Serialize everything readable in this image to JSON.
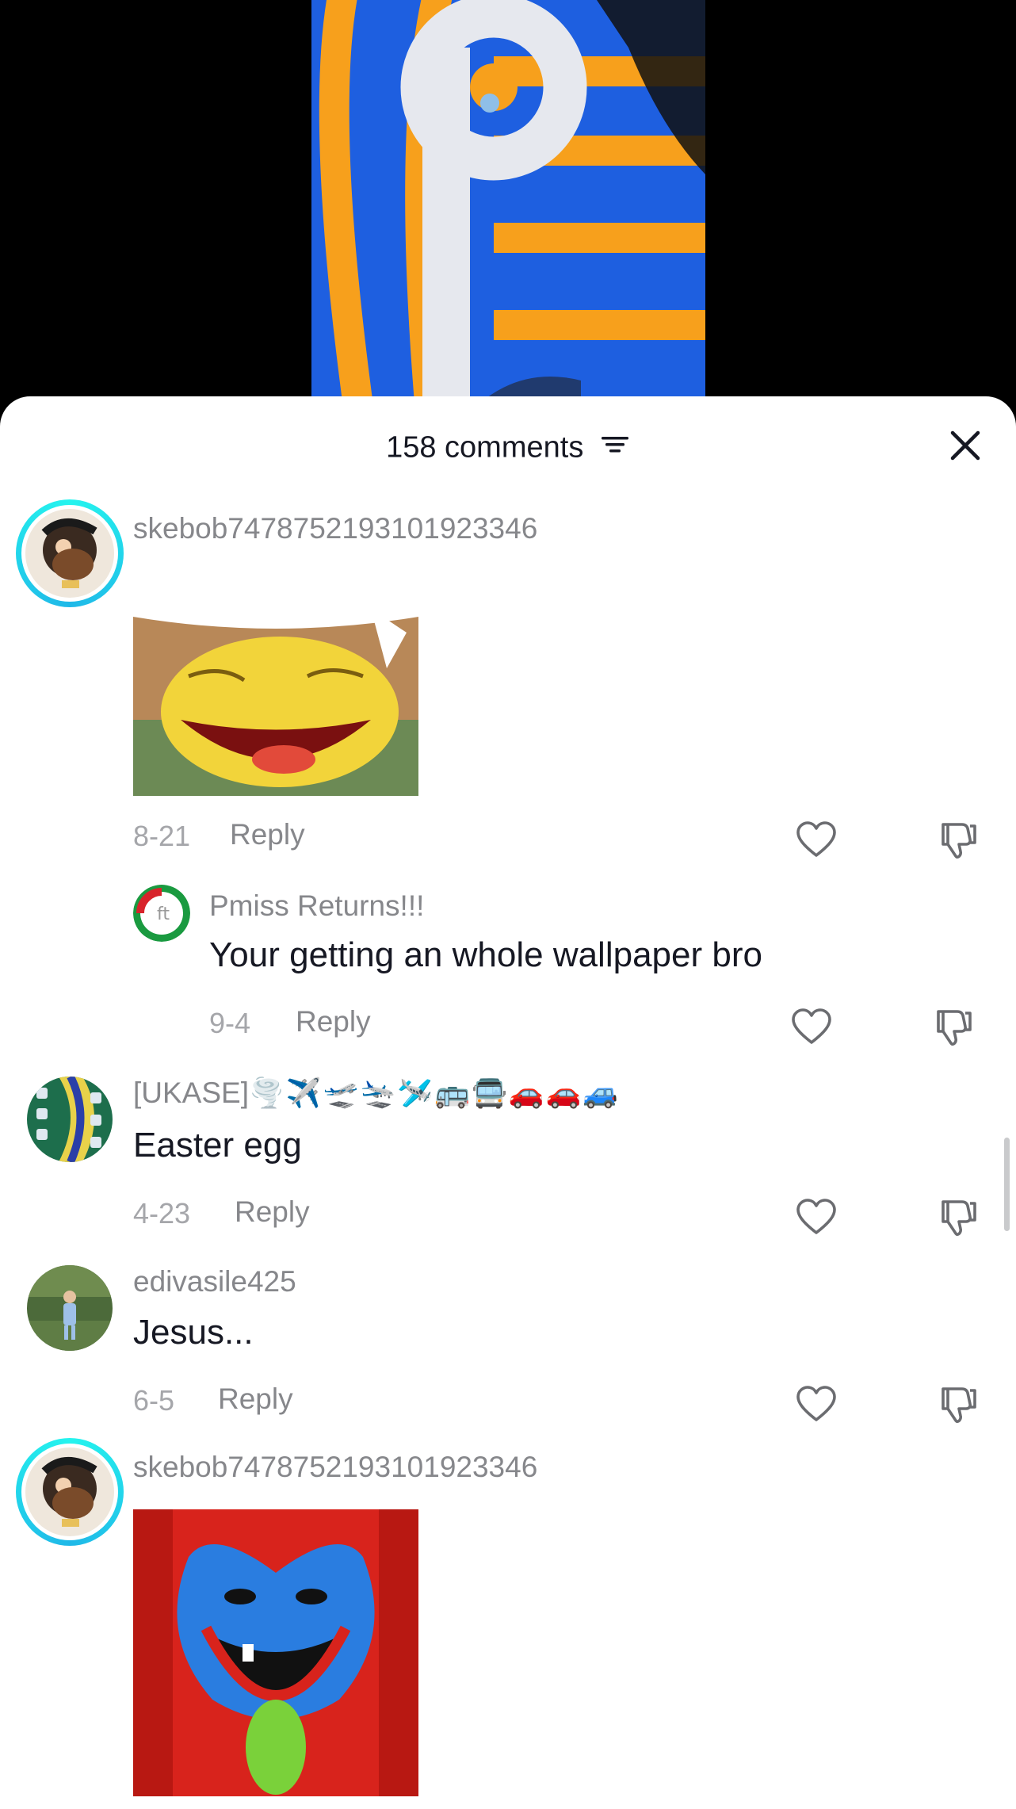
{
  "video": {
    "icon": "video-preview"
  },
  "sheet": {
    "comment_count_label": "158 comments",
    "filter_icon": "filter-icon",
    "close_icon": "close-icon"
  },
  "comments": [
    {
      "username": "skebob7478752193101923346",
      "media": "laughing-cartoon-sticker",
      "date": "8-21",
      "reply_label": "Reply"
    },
    {
      "username": "Pmiss Returns!!!",
      "text": "Your getting an whole wallpaper bro",
      "date": "9-4",
      "reply_label": "Reply"
    },
    {
      "username": "[UKASE]",
      "username_emoji": "🌪️✈️🛫🛬🛩️🚌🚍🚗🚗🚙",
      "text": "Easter egg",
      "date": "4-23",
      "reply_label": "Reply"
    },
    {
      "username": "edivasile425",
      "text": "Jesus...",
      "date": "6-5",
      "reply_label": "Reply"
    },
    {
      "username": "skebob7478752193101923346",
      "media": "blue-monster-laughing-sticker"
    }
  ],
  "icons": {
    "like": "heart-icon",
    "dislike": "thumbs-down-icon"
  },
  "colors": {
    "accent_ring": "#25F4EE",
    "text_primary": "#161823",
    "text_secondary": "#86878b"
  }
}
